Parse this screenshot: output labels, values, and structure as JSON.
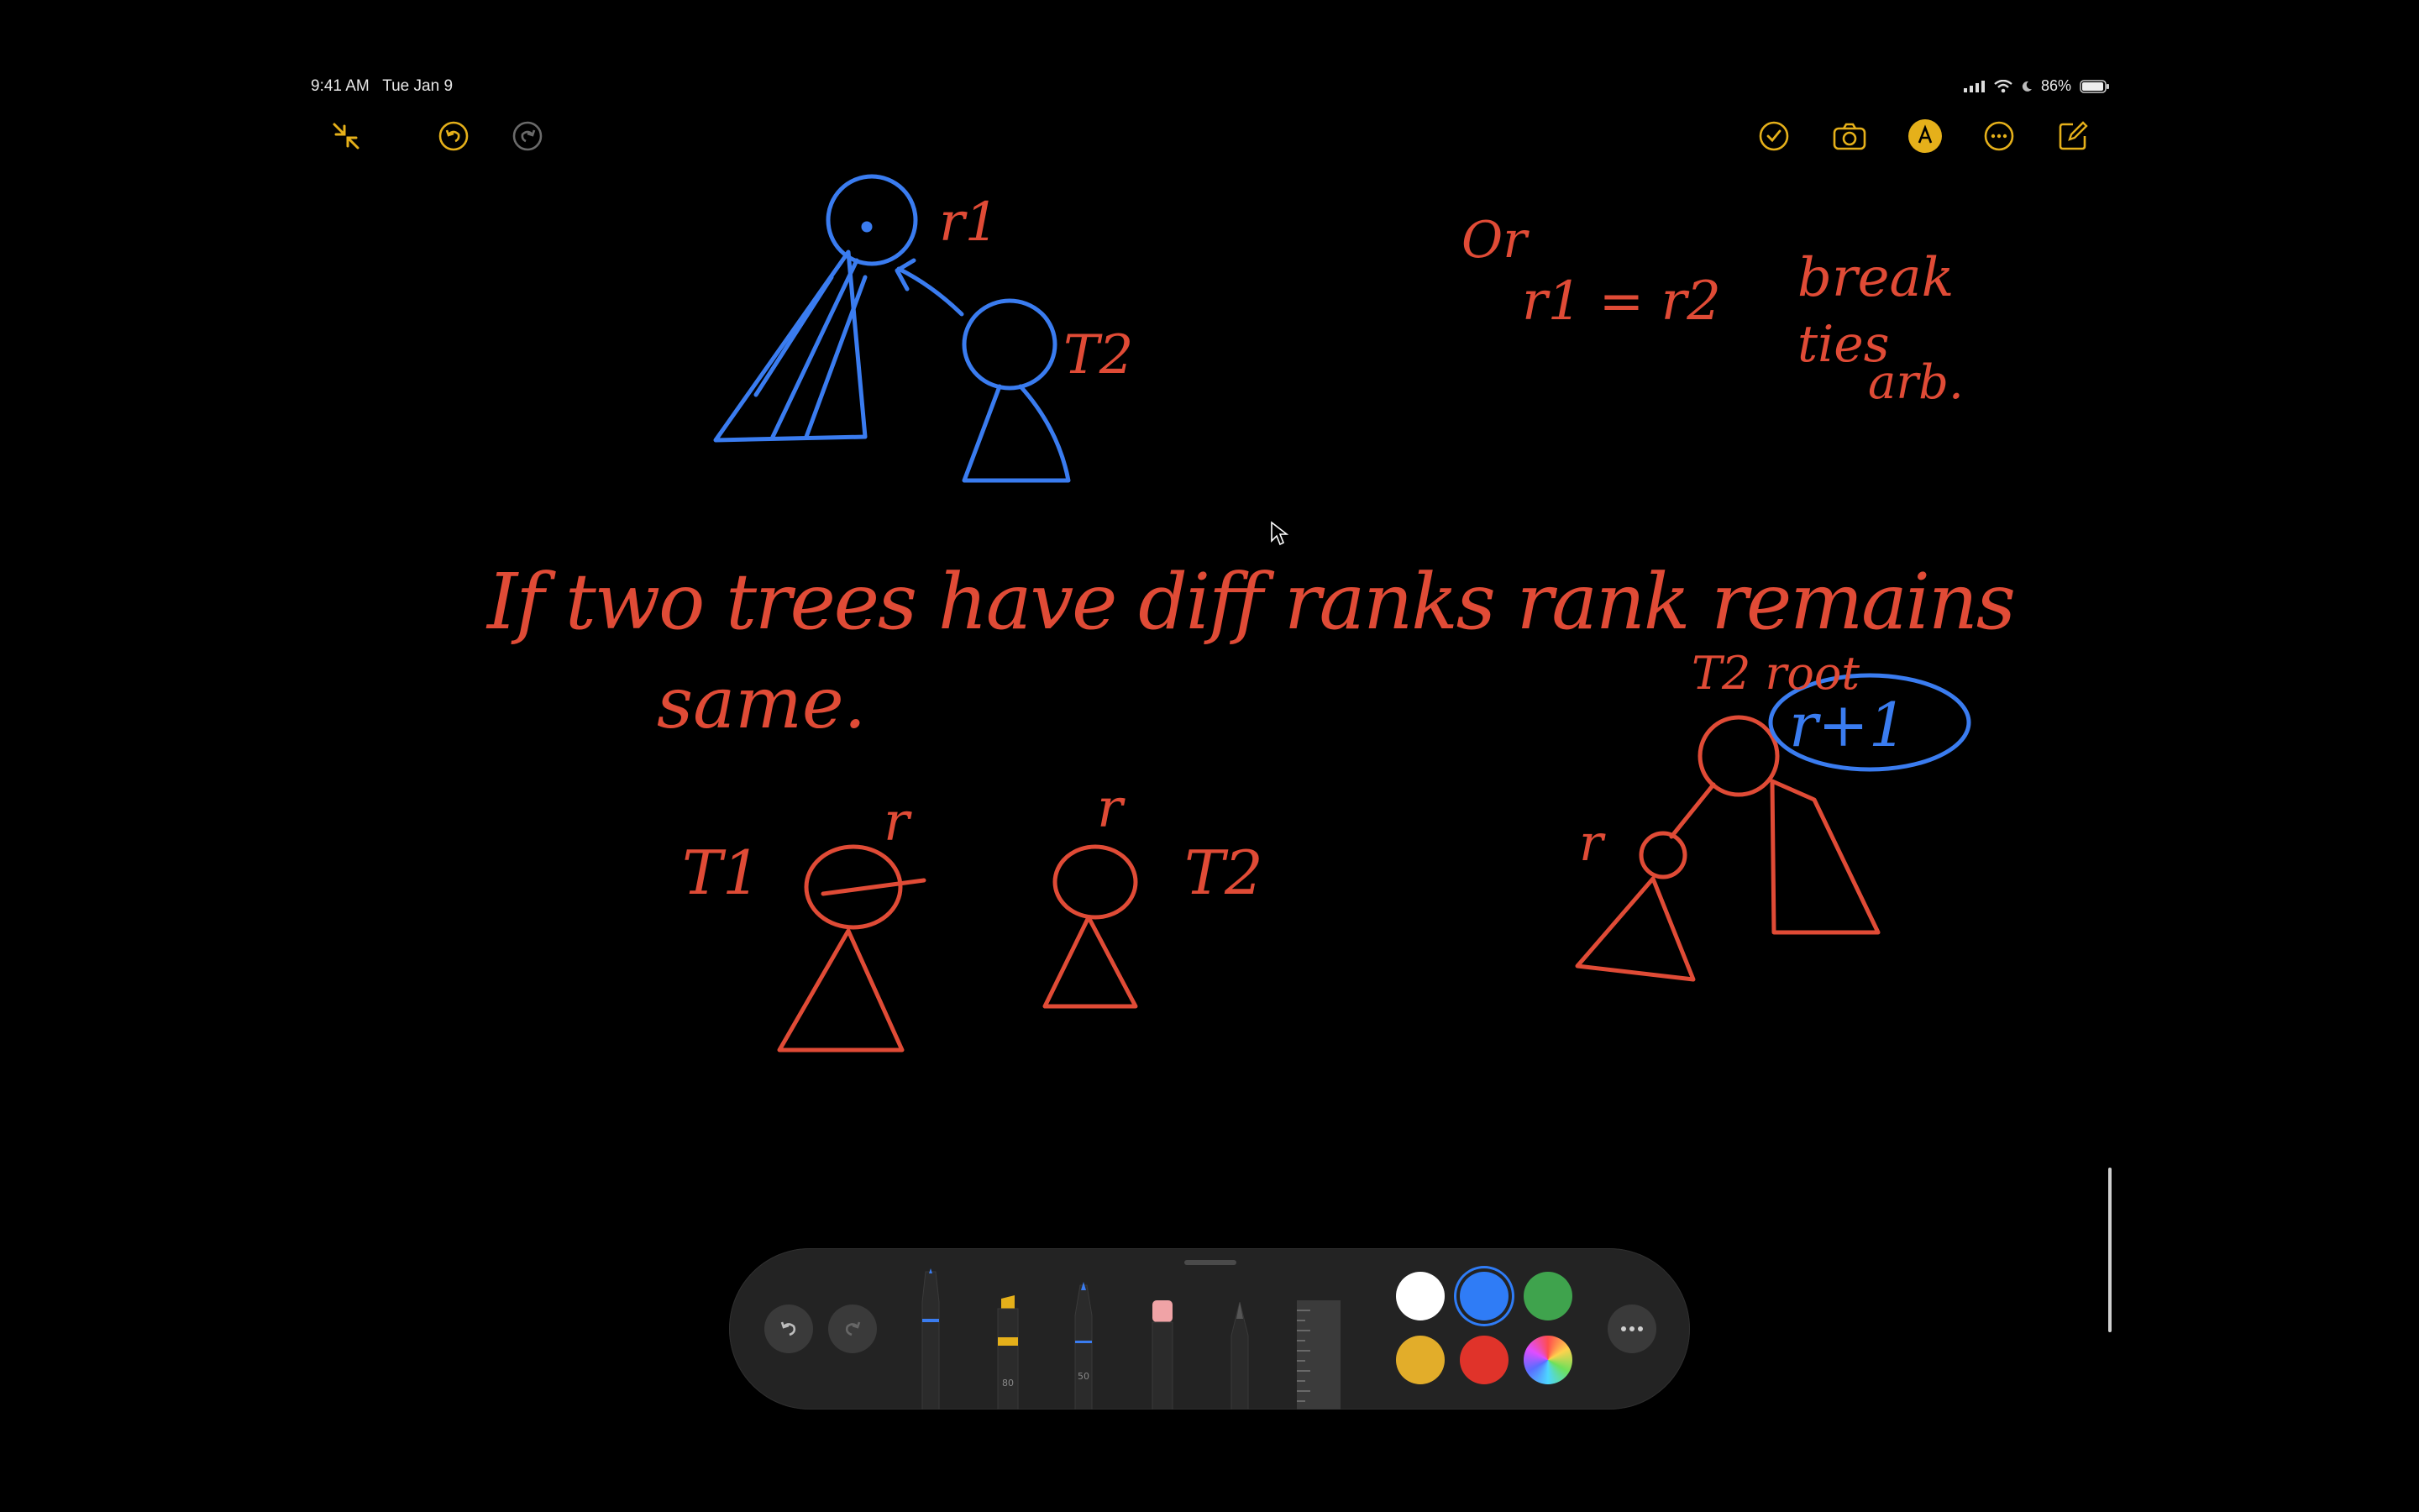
{
  "status_bar": {
    "time": "9:41 AM",
    "date": "Tue Jan 9",
    "battery": "86%"
  },
  "toolbar_left": [
    "collapse-icon",
    "undo-icon",
    "redo-icon"
  ],
  "toolbar_right": [
    "checklist-icon",
    "camera-icon",
    "markup-icon",
    "more-icon",
    "compose-icon"
  ],
  "note_handwriting": {
    "text_or": "Or",
    "text_eq": "r1 = r2",
    "text_break": "break",
    "text_ties": "ties",
    "text_arb": "arb.",
    "r1_label": "r1",
    "T2_top_label": "T2",
    "line1": "If two trees have diff ranks rank remains",
    "line2": "same.",
    "T1_label": "T1",
    "r_label_a": "r",
    "r_label_b": "r",
    "T2_bottom_label": "T2",
    "T2_root_label": "T2 root",
    "r_plus_one": "r+1",
    "r_label_c": "r"
  },
  "palette": {
    "tools": [
      "pen",
      "highlighter",
      "pencil-blue",
      "eraser",
      "pencil",
      "ruler"
    ],
    "marker_size_labels": [
      "80",
      "50"
    ],
    "colors": [
      "#ffffff",
      "#2f7cf6",
      "#3fa34d",
      "#e2ad2a",
      "#e0332a",
      "color-wheel"
    ],
    "selected_color": "#2f7cf6"
  },
  "colors": {
    "accent": "#e5b01a",
    "ink_blue": "#3a7cf0",
    "ink_red": "#e04b36"
  }
}
